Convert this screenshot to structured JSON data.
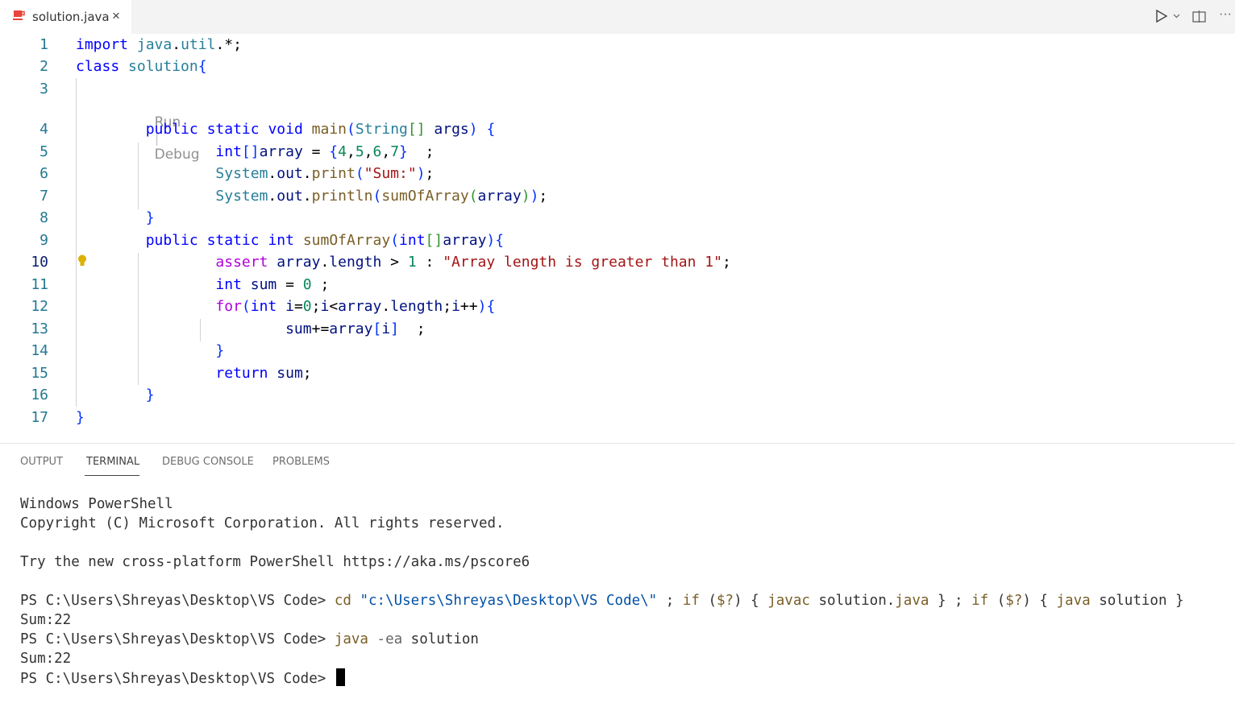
{
  "tab": {
    "title": "solution.java",
    "close": "×",
    "icon": "java-coffee-icon"
  },
  "toolbar": {
    "run_icon": "run-icon",
    "chevron_icon": "chevron-down-icon",
    "split_icon": "split-editor-icon",
    "more": "···"
  },
  "editor": {
    "current_line": "10",
    "codelens": {
      "run": "Run",
      "sep": "|",
      "debug": "Debug"
    },
    "line_numbers": [
      "1",
      "2",
      "3",
      "4",
      "5",
      "6",
      "7",
      "8",
      "9",
      "10",
      "11",
      "12",
      "13",
      "14",
      "15",
      "16",
      "17"
    ],
    "lines": [
      "import java.util.*;",
      "class solution{",
      "",
      "        public static void main(String[] args) {",
      "                int[]array = {4,5,6,7}  ;",
      "                System.out.print(\"Sum:\");",
      "                System.out.println(sumOfArray(array));",
      "        }",
      "        public static int sumOfArray(int[]array){",
      "                assert array.length > 1 : \"Array length is greater than 1\";",
      "                int sum = 0 ;",
      "                for(int i=0;i<array.length;i++){",
      "                        sum+=array[i]  ;",
      "                }",
      "                return sum;",
      "        }",
      "}"
    ]
  },
  "panel": {
    "tabs": [
      "OUTPUT",
      "TERMINAL",
      "DEBUG CONSOLE",
      "PROBLEMS"
    ],
    "active_tab": "TERMINAL"
  },
  "terminal": {
    "lines": [
      "Windows PowerShell",
      "Copyright (C) Microsoft Corporation. All rights reserved.",
      "",
      "Try the new cross-platform PowerShell https://aka.ms/pscore6",
      "",
      "PS C:\\Users\\Shreyas\\Desktop\\VS Code> cd \"c:\\Users\\Shreyas\\Desktop\\VS Code\\\" ; if ($?) { javac solution.java } ; if ($?) { java solution }",
      "Sum:22",
      "PS C:\\Users\\Shreyas\\Desktop\\VS Code> java -ea solution",
      "Sum:22",
      "PS C:\\Users\\Shreyas\\Desktop\\VS Code> "
    ]
  }
}
